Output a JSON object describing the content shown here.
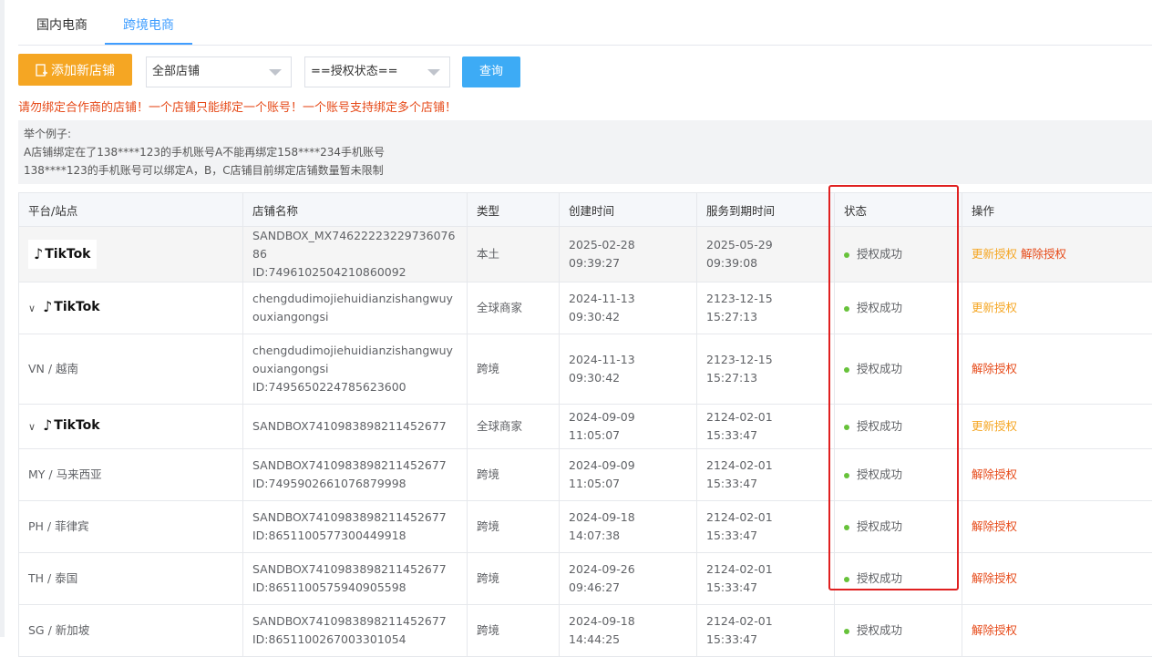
{
  "tabs": [
    {
      "label": "国内电商",
      "active": false
    },
    {
      "label": "跨境电商",
      "active": true
    }
  ],
  "toolbar": {
    "add_label": "添加新店铺",
    "store_select": "全部店铺",
    "auth_select": "==授权状态==",
    "query_label": "查询"
  },
  "warning": "请勿绑定合作商的店铺！一个店铺只能绑定一个账号！一个账号支持绑定多个店铺！",
  "example": {
    "title": "举个例子:",
    "line1": "A店铺绑定在了138****123的手机账号A不能再绑定158****234手机账号",
    "line2": "138****123的手机账号可以绑定A，B，C店铺目前绑定店铺数量暂未限制"
  },
  "table": {
    "headers": [
      "平台/站点",
      "店铺名称",
      "类型",
      "创建时间",
      "服务到期时间",
      "状态",
      "操作"
    ],
    "rows": [
      {
        "platform": "TikTok",
        "logo": true,
        "expand": false,
        "name": "SANDBOX_MX7462222322973607686",
        "id": "ID:7496102504210860092",
        "type": "本土",
        "created": "2025-02-28 09:39:27",
        "expires": "2025-05-29 09:39:08",
        "status": "授权成功",
        "op1": "更新授权",
        "op2": "解除授权"
      },
      {
        "platform": "TikTok",
        "logo": true,
        "expand": true,
        "name": "chengdudimojiehuidianzishangwuyouxiangongsi",
        "id": "",
        "type": "全球商家",
        "created": "2024-11-13 09:30:42",
        "expires": "2123-12-15 15:27:13",
        "status": "授权成功",
        "op1": "更新授权",
        "op2": ""
      },
      {
        "platform": "VN / 越南",
        "logo": false,
        "expand": false,
        "name": "chengdudimojiehuidianzishangwuyouxiangongsi",
        "id": "ID:7495650224785623600",
        "type": "跨境",
        "created": "2024-11-13 09:30:42",
        "expires": "2123-12-15 15:27:13",
        "status": "授权成功",
        "op1": "",
        "op2": "解除授权"
      },
      {
        "platform": "TikTok",
        "logo": true,
        "expand": true,
        "name": "SANDBOX7410983898211452677",
        "id": "",
        "type": "全球商家",
        "created": "2024-09-09 11:05:07",
        "expires": "2124-02-01 15:33:47",
        "status": "授权成功",
        "op1": "更新授权",
        "op2": ""
      },
      {
        "platform": "MY / 马来西亚",
        "logo": false,
        "expand": false,
        "name": "SANDBOX7410983898211452677",
        "id": "ID:7495902661076879998",
        "type": "跨境",
        "created": "2024-09-09 11:05:07",
        "expires": "2124-02-01 15:33:47",
        "status": "授权成功",
        "op1": "",
        "op2": "解除授权"
      },
      {
        "platform": "PH / 菲律宾",
        "logo": false,
        "expand": false,
        "name": "SANDBOX7410983898211452677",
        "id": "ID:8651100577300449918",
        "type": "跨境",
        "created": "2024-09-18 14:07:38",
        "expires": "2124-02-01 15:33:47",
        "status": "授权成功",
        "op1": "",
        "op2": "解除授权"
      },
      {
        "platform": "TH / 泰国",
        "logo": false,
        "expand": false,
        "name": "SANDBOX7410983898211452677",
        "id": "ID:8651100575940905598",
        "type": "跨境",
        "created": "2024-09-26 09:46:27",
        "expires": "2124-02-01 15:33:47",
        "status": "授权成功",
        "op1": "",
        "op2": "解除授权"
      },
      {
        "platform": "SG / 新加坡",
        "logo": false,
        "expand": false,
        "name": "SANDBOX7410983898211452677",
        "id": "ID:8651100267003301054",
        "type": "跨境",
        "created": "2024-09-18 14:44:25",
        "expires": "2124-02-01 15:33:47",
        "status": "授权成功",
        "op1": "",
        "op2": "解除授权"
      }
    ]
  },
  "colors": {
    "accent": "#409eff",
    "add_button": "#f5a623",
    "query_button": "#3dabf5",
    "warning": "#e64a19",
    "status_dot": "#67c23a",
    "highlight_box": "#e02020"
  }
}
